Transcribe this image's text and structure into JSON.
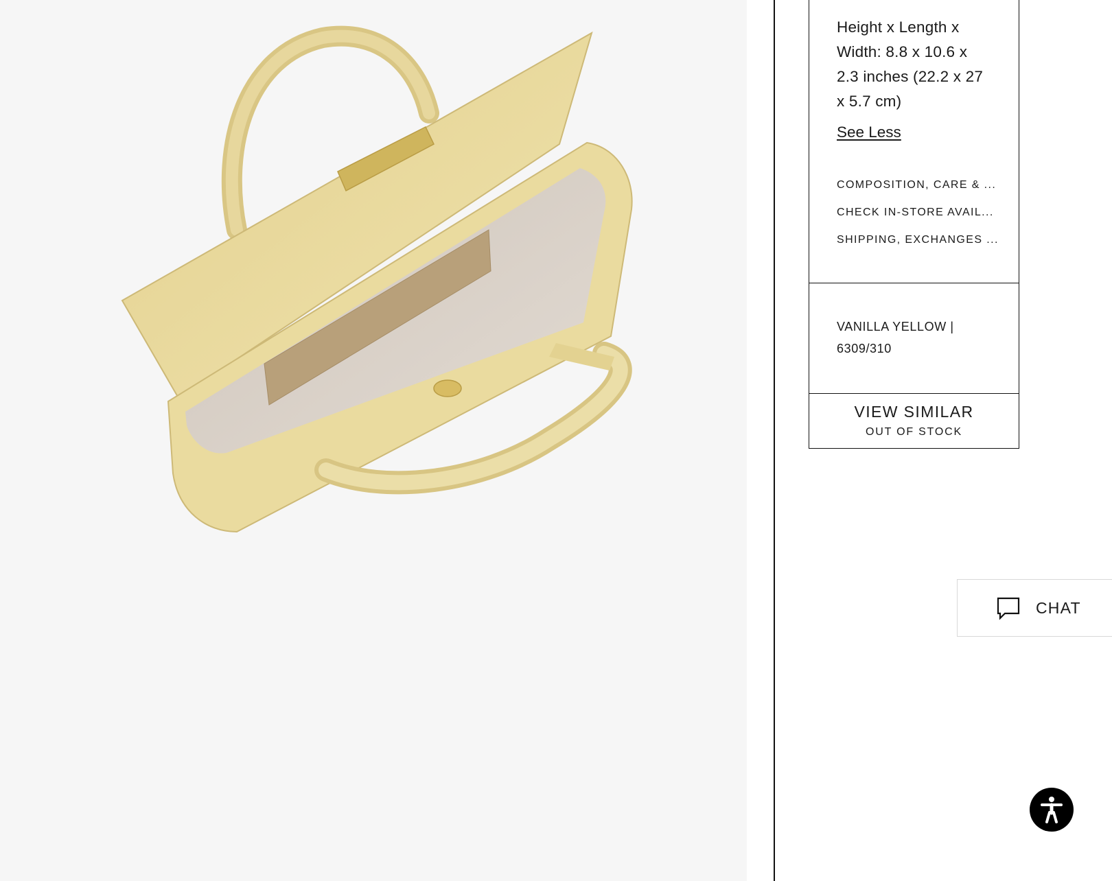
{
  "product_image": {
    "alt": "Vanilla yellow leather handbag, open, viewed from above"
  },
  "details": {
    "dimension_lines": [
      "Height x Length x",
      "Width: 8.8 x 10.6 x",
      "2.3 inches (22.2 x 27",
      "x 5.7 cm)"
    ],
    "see_less_label": "See Less"
  },
  "accordion": {
    "items": [
      {
        "label": "COMPOSITION, CARE & ..."
      },
      {
        "label": "CHECK IN-STORE AVAIL..."
      },
      {
        "label": "SHIPPING, EXCHANGES ..."
      }
    ]
  },
  "color_info": {
    "line1": "VANILLA YELLOW |",
    "line2": "6309/310"
  },
  "cta": {
    "label": "VIEW SIMILAR",
    "sublabel": "OUT OF STOCK"
  },
  "chat": {
    "label": "CHAT",
    "icon": "chat-bubble-icon"
  },
  "accessibility": {
    "icon": "accessibility-person-icon"
  },
  "colors": {
    "image_background": "#f6f6f6",
    "bag_leather": "#e6d596",
    "bag_lining": "#d9d1c7",
    "border": "#111111",
    "chat_border": "#d8d8d8"
  }
}
